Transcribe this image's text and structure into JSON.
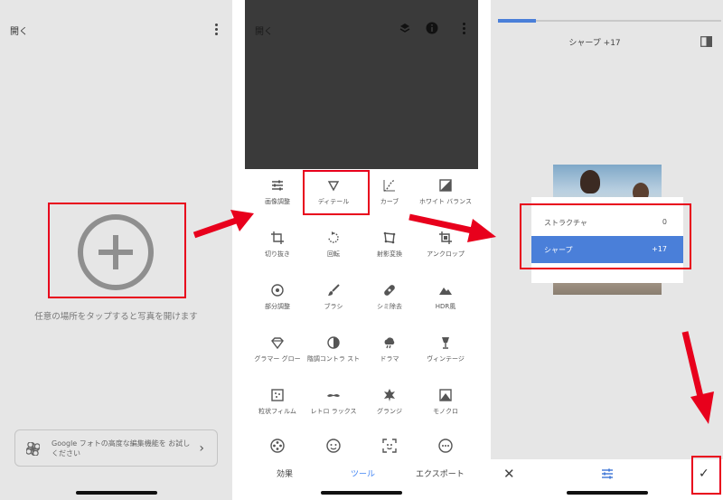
{
  "screen1": {
    "title": "開く",
    "hint": "任意の場所をタップすると写真を開けます",
    "promo": "Google フォトの高度な編集機能を お試しください"
  },
  "screen2": {
    "title": "開く",
    "tools": [
      {
        "label": "画像調整",
        "icon": "tune-icon"
      },
      {
        "label": "ディテール",
        "icon": "triangle-down-icon"
      },
      {
        "label": "カーブ",
        "icon": "curve-icon"
      },
      {
        "label": "ホワイト バランス",
        "icon": "white-balance-icon"
      },
      {
        "label": "切り抜き",
        "icon": "crop-icon"
      },
      {
        "label": "回転",
        "icon": "rotate-icon"
      },
      {
        "label": "射影変換",
        "icon": "perspective-icon"
      },
      {
        "label": "アンクロップ",
        "icon": "expand-icon"
      },
      {
        "label": "部分調整",
        "icon": "selective-icon"
      },
      {
        "label": "ブラシ",
        "icon": "brush-icon"
      },
      {
        "label": "シミ除去",
        "icon": "healing-icon"
      },
      {
        "label": "HDR風",
        "icon": "mountain-icon"
      },
      {
        "label": "グラマー グロー",
        "icon": "diamond-icon"
      },
      {
        "label": "階調コントラ スト",
        "icon": "contrast-icon"
      },
      {
        "label": "ドラマ",
        "icon": "cloud-icon"
      },
      {
        "label": "ヴィンテージ",
        "icon": "lamp-icon"
      },
      {
        "label": "粒状フィルム",
        "icon": "grain-icon"
      },
      {
        "label": "レトロ ラックス",
        "icon": "mustache-icon"
      },
      {
        "label": "グランジ",
        "icon": "grunge-icon"
      },
      {
        "label": "モノクロ",
        "icon": "mono-icon"
      }
    ],
    "tabs": [
      {
        "label": "効果",
        "active": false
      },
      {
        "label": "ツール",
        "active": true
      },
      {
        "label": "エクスポート",
        "active": false
      }
    ],
    "accent_color": "#4285f4"
  },
  "screen3": {
    "value_label": "シャープ +17",
    "progress": 0.17,
    "menu": [
      {
        "name": "ストラクチャ",
        "value": "0",
        "selected": false
      },
      {
        "name": "シャープ",
        "value": "+17",
        "selected": true
      }
    ],
    "highlight_color": "#4a7fd9"
  },
  "annotation_color": "#e8001c"
}
